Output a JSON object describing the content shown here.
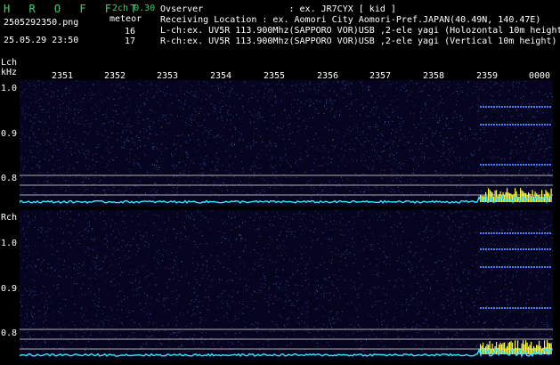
{
  "header": {
    "brand": "H R O F F T",
    "version": "2ch 0.30",
    "filename": "2505292350.png",
    "meteor_label": "meteor",
    "lch_count": "16",
    "rch_count": "17",
    "timestamp": "25.05.29 23:50",
    "observer": "Ovserver                : ex. JR7CYX [ kid ]",
    "location": "Receiving Location : ex. Aomori City Aomori-Pref.JAPAN(40.49N, 140.47E)",
    "lch_info": "L-ch:ex. UV5R 113.900Mhz(SAPPORO VOR)USB ,2-ele yagi (Holozontal 10m height)",
    "rch_info": "R-ch:ex. UV5R 113.900Mhz(SAPPORO VOR)USB ,2-ele yagi (Vertical 10m height)"
  },
  "axis": {
    "lch_label": "Lch",
    "khz_label": "kHz",
    "rch_label": "Rch",
    "freq_ticks_lch": [
      "1.0",
      "0.9",
      "0.8"
    ],
    "freq_ticks_rch": [
      "1.0",
      "0.9",
      "0.8"
    ],
    "time_ticks": [
      "2351",
      "2352",
      "2353",
      "2354",
      "2355",
      "2356",
      "2357",
      "2358",
      "2359",
      "0000"
    ]
  },
  "colors": {
    "background": "#000000",
    "spectrogram_bg": "#050520",
    "brand_green": "#3fd07a",
    "trace_cyan": "#37e6ff",
    "burst_yellow": "#ffff40",
    "guide_line": "#c8c8c8"
  }
}
